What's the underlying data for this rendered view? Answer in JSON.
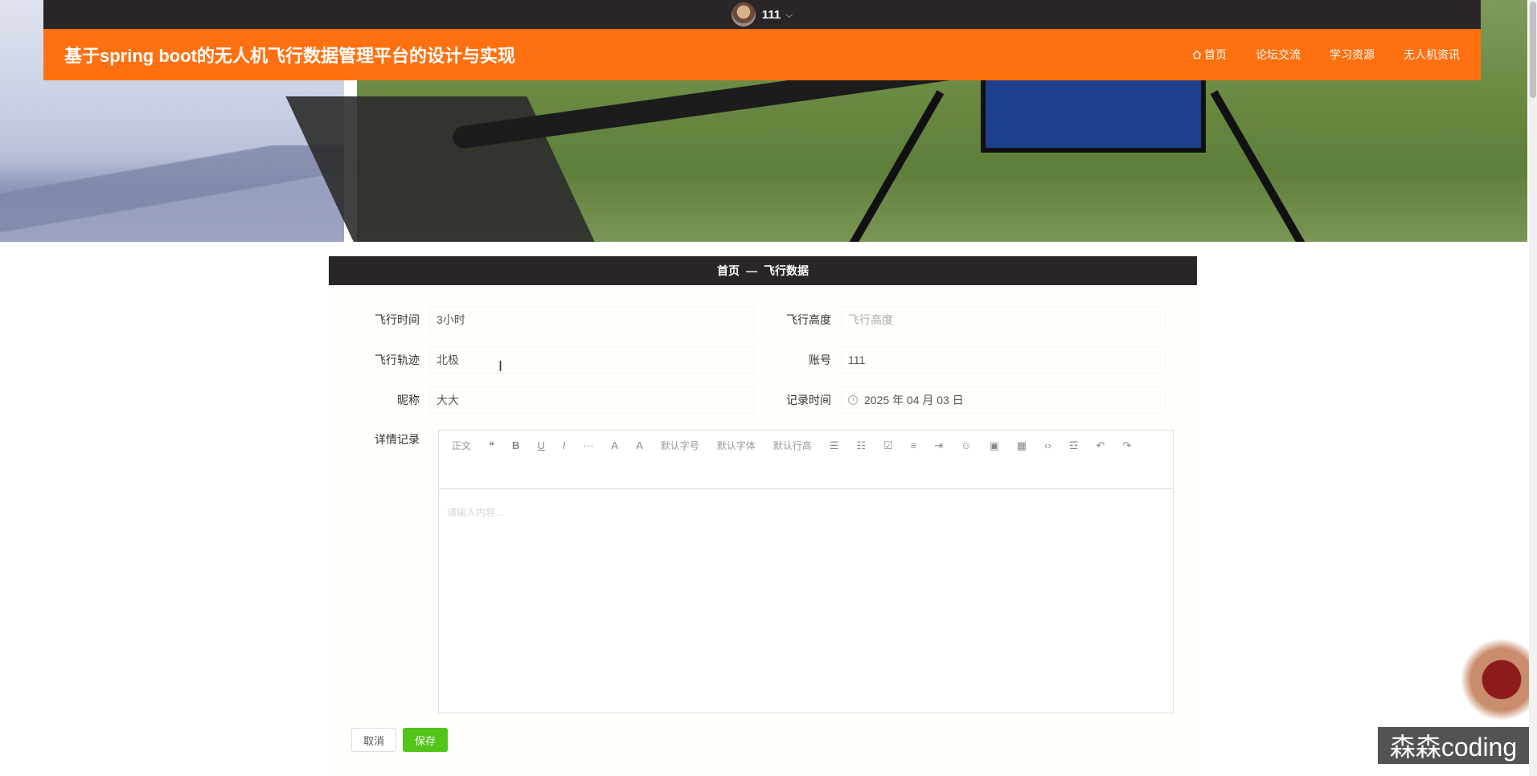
{
  "user": {
    "name": "111"
  },
  "header": {
    "title": "基于spring boot的无人机飞行数据管理平台的设计与实现",
    "nav": [
      {
        "label": "首页",
        "icon": "home-icon"
      },
      {
        "label": "论坛交流"
      },
      {
        "label": "学习资源"
      },
      {
        "label": "无人机资讯"
      }
    ]
  },
  "breadcrumb": {
    "home": "首页",
    "sep": "—",
    "current": "飞行数据"
  },
  "form": {
    "flight_time": {
      "label": "飞行时间",
      "value": "3小时"
    },
    "flight_height": {
      "label": "飞行高度",
      "placeholder": "飞行高度"
    },
    "flight_track": {
      "label": "飞行轨迹",
      "value": "北极"
    },
    "account": {
      "label": "账号",
      "value": "111"
    },
    "nickname": {
      "label": "昵称",
      "value": "大大"
    },
    "record_time": {
      "label": "记录时间",
      "value": "2025 年 04 月 03 日"
    },
    "detail": {
      "label": "详情记录",
      "placeholder": "请输入内容..."
    }
  },
  "editor_toolbar": {
    "row1": [
      "正文",
      "❝",
      "B",
      "U",
      "I",
      "···",
      "A",
      "A",
      "默认字号",
      "默认字体",
      "默认行高",
      "☰",
      "☷",
      "☑",
      "≡",
      "⇥",
      "☺",
      "▣"
    ],
    "row2": [
      "▦",
      "‹›",
      "☲",
      "↶",
      "↷"
    ]
  },
  "buttons": {
    "cancel": "取消",
    "save": "保存"
  },
  "watermark": "森森coding",
  "colors": {
    "header": "#ff7010",
    "dark_bar": "#2a2627",
    "save": "#52c41a"
  }
}
